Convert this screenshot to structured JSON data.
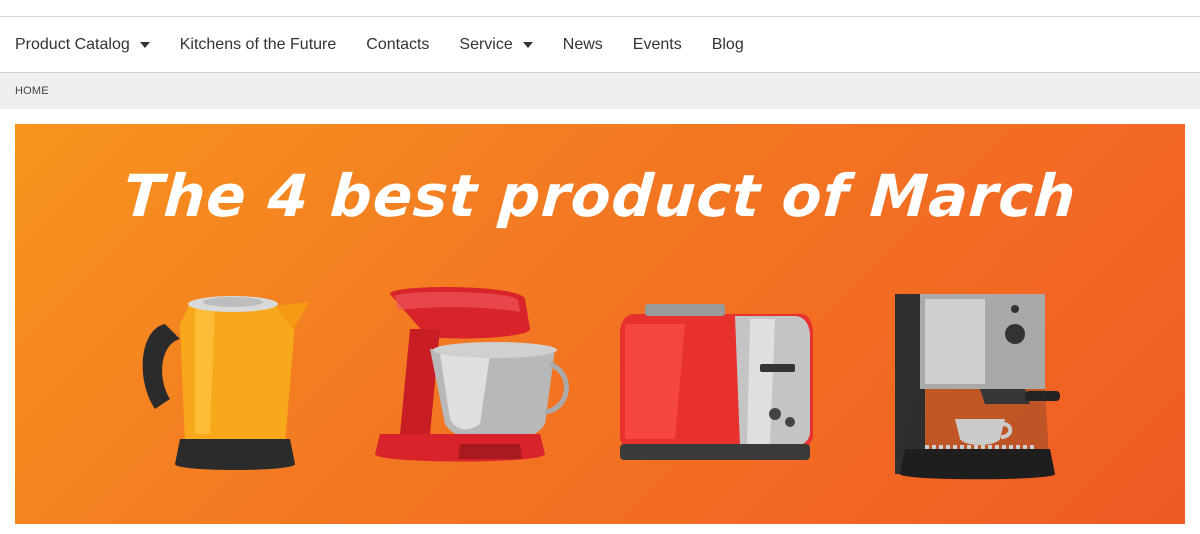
{
  "nav": {
    "items": [
      {
        "label": "Product Catalog",
        "dropdown": true
      },
      {
        "label": "Kitchens of the Future",
        "dropdown": false
      },
      {
        "label": "Contacts",
        "dropdown": false
      },
      {
        "label": "Service",
        "dropdown": true
      },
      {
        "label": "News",
        "dropdown": false
      },
      {
        "label": "Events",
        "dropdown": false
      },
      {
        "label": "Blog",
        "dropdown": false
      }
    ]
  },
  "breadcrumb": {
    "home": "HOME"
  },
  "banner": {
    "title": "The 4 best product of March",
    "products": [
      "kettle",
      "stand mixer",
      "toaster",
      "espresso machine"
    ],
    "colors": {
      "start": "#f7941d",
      "end": "#f05a24"
    }
  }
}
